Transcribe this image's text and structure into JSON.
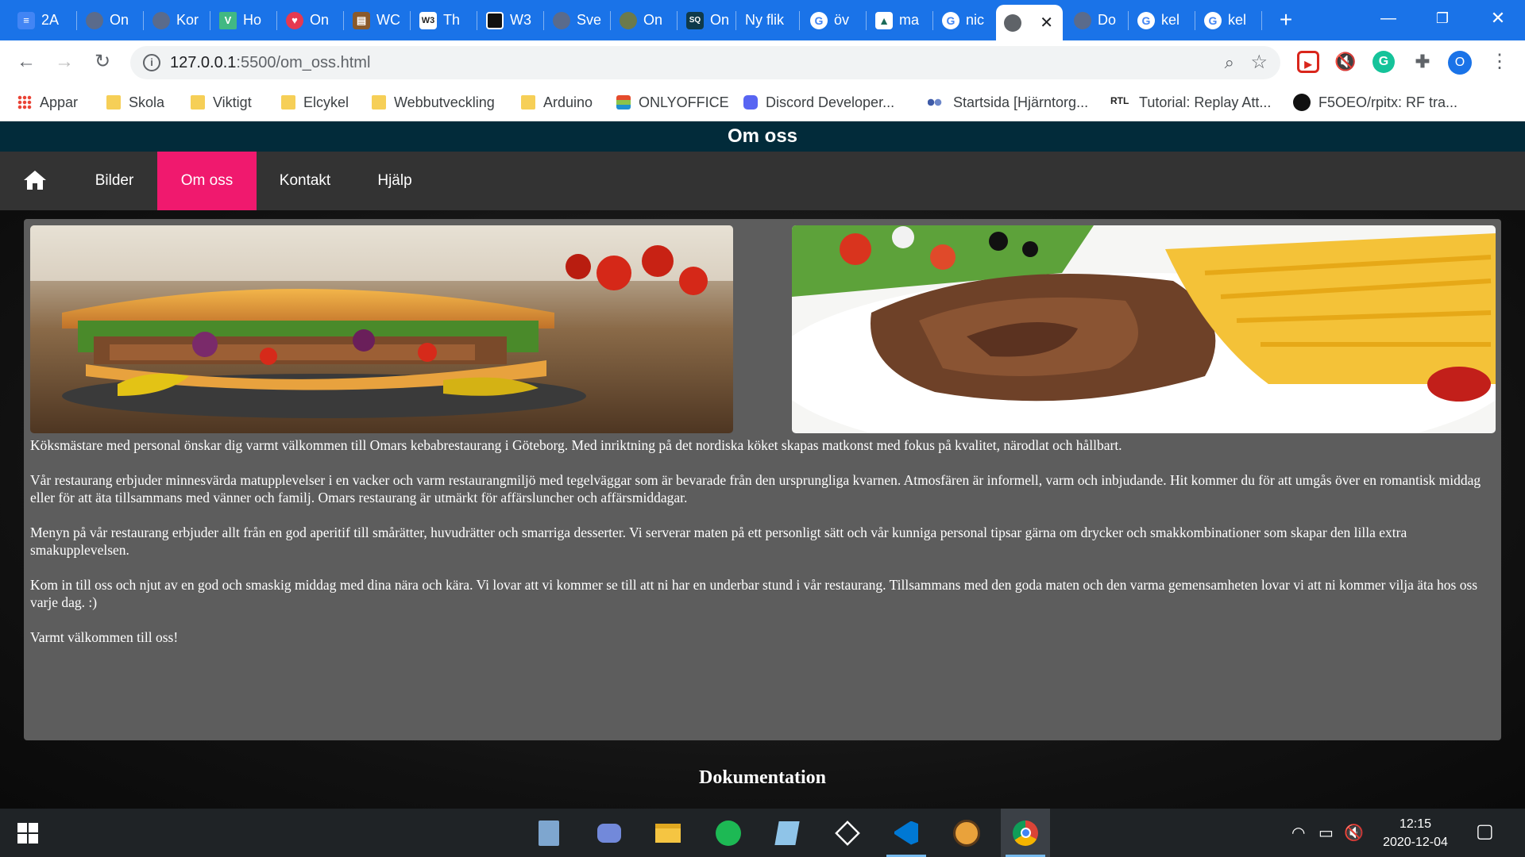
{
  "browser": {
    "tabs": [
      {
        "label": "2A",
        "icon": "docs-icon",
        "color": "#4285f4"
      },
      {
        "label": "On",
        "icon": "globe-icon",
        "color": "#5a6b8c"
      },
      {
        "label": "Kor",
        "icon": "globe-icon",
        "color": "#5a6b8c"
      },
      {
        "label": "Ho",
        "icon": "vue-icon",
        "color": "#41b883"
      },
      {
        "label": "On",
        "icon": "heart-icon",
        "color": "#e53950"
      },
      {
        "label": "WC",
        "icon": "bars-icon",
        "color": "#8a5a2b"
      },
      {
        "label": "Th",
        "icon": "w3-icon",
        "color": "#222"
      },
      {
        "label": "W3",
        "icon": "puzzle-icon",
        "color": "#111"
      },
      {
        "label": "Sve",
        "icon": "globe-icon",
        "color": "#5a6b8c"
      },
      {
        "label": "On",
        "icon": "doc-icon",
        "color": "#6b7a4b"
      },
      {
        "label": "On",
        "icon": "sq-icon",
        "color": "#0f3a4a"
      },
      {
        "label": "Ny flik",
        "icon": "",
        "color": ""
      },
      {
        "label": "öv",
        "icon": "google-icon",
        "color": "#fff"
      },
      {
        "label": "ma",
        "icon": "hat-icon",
        "color": "#1b6b5a"
      },
      {
        "label": "nic",
        "icon": "google-icon",
        "color": "#fff"
      },
      {
        "label": "",
        "icon": "globe-icon",
        "color": "#5f6368"
      },
      {
        "label": "Do",
        "icon": "globe-icon",
        "color": "#5a6b8c"
      },
      {
        "label": "kel",
        "icon": "google-icon",
        "color": "#fff"
      },
      {
        "label": "kel",
        "icon": "google-icon",
        "color": "#fff"
      }
    ],
    "new_tab": "+",
    "url_host": "127.0.0.1",
    "url_path": ":5500/om_oss.html",
    "profile_initial": "O",
    "bookmarks": [
      {
        "label": "Appar",
        "icon": "apps-grid-icon"
      },
      {
        "label": "Skola",
        "icon": "folder-icon"
      },
      {
        "label": "Viktigt",
        "icon": "folder-icon"
      },
      {
        "label": "Elcykel",
        "icon": "folder-icon"
      },
      {
        "label": "Webbutveckling",
        "icon": "folder-icon"
      },
      {
        "label": "Arduino",
        "icon": "folder-icon"
      },
      {
        "label": "ONLYOFFICE",
        "icon": "onlyoffice-icon"
      },
      {
        "label": "Discord Developer...",
        "icon": "discord-icon"
      },
      {
        "label": "Startsida [Hjärntorg...",
        "icon": "dots-icon"
      },
      {
        "label": "Tutorial: Replay Att...",
        "icon": "rtl-icon"
      },
      {
        "label": "F5OEO/rpitx: RF tra...",
        "icon": "github-icon"
      }
    ],
    "rtl_text": "RTL"
  },
  "site": {
    "header_title": "Om oss",
    "nav": [
      {
        "label": "Bilder",
        "active": false
      },
      {
        "label": "Om oss",
        "active": true
      },
      {
        "label": "Kontakt",
        "active": false
      },
      {
        "label": "Hjälp",
        "active": false
      }
    ],
    "accent_color": "#f0196e",
    "header_color": "#022b3a",
    "paragraphs": [
      "Köksmästare med personal önskar dig varmt välkommen till Omars kebabrestaurang i Göteborg. Med inriktning på det nordiska köket skapas matkonst med fokus på kvalitet, närodlat och hållbart.",
      "Vår restaurang erbjuder minnesvärda matupplevelser i en vacker och varm restaurangmiljö med tegelväggar som är bevarade från den ursprungliga kvarnen. Atmosfären är informell, varm och inbjudande. Hit kommer du för att umgås över en romantisk middag eller för att äta tillsammans med vänner och familj. Omars restaurang är utmärkt för affärsluncher och affärsmiddagar.",
      "Menyn på vår restaurang erbjuder allt från en god aperitif till smårätter, huvudrätter och smarriga desserter. Vi serverar maten på ett personligt sätt och vår kunniga personal tipsar gärna om drycker och smakkombinationer som skapar den lilla extra smakupplevelsen.",
      "Kom in till oss och njut av en god och smaskig middag med dina nära och kära. Vi lovar att vi kommer se till att ni har en underbar stund i vår restaurang. Tillsammans med den goda maten och den varma gemensamheten lovar vi att ni kommer vilja äta hos oss varje dag. :)",
      "Varmt välkommen till oss!"
    ],
    "footer_title": "Dokumentation"
  },
  "taskbar": {
    "apps": [
      "calculator-icon",
      "discord-icon",
      "file-explorer-icon",
      "spotify-icon",
      "notepad-icon",
      "unity-icon",
      "vscode-icon",
      "shoes-game-icon",
      "chrome-icon"
    ],
    "time": "12:15",
    "date": "2020-12-04"
  }
}
